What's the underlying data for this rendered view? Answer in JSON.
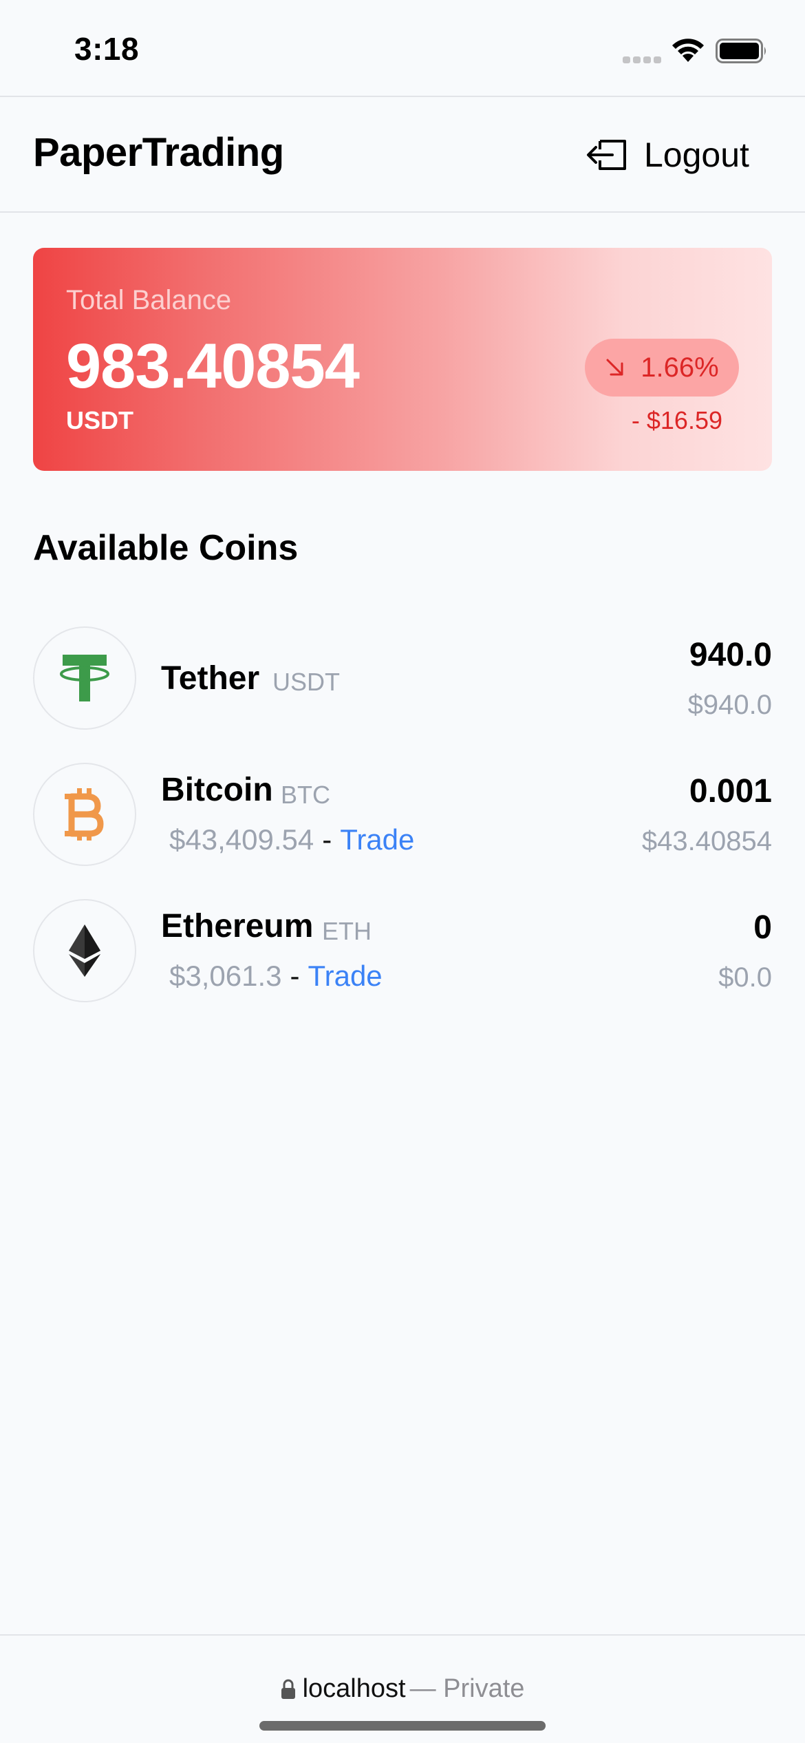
{
  "status_bar": {
    "time": "3:18"
  },
  "header": {
    "title": "PaperTrading",
    "logout_label": "Logout"
  },
  "balance": {
    "label": "Total Balance",
    "value": "983.40854",
    "currency": "USDT",
    "change_percent": "1.66%",
    "change_amount": "- $16.59",
    "change_direction": "down"
  },
  "coins_section": {
    "title": "Available Coins"
  },
  "coins": [
    {
      "name": "Tether",
      "symbol": "USDT",
      "price": "",
      "trade_label": "",
      "amount": "940.0",
      "value": "$940.0",
      "icon": "tether-icon",
      "color": "#3d9b4a"
    },
    {
      "name": "Bitcoin",
      "symbol": "BTC",
      "price": "$43,409.54",
      "separator": "-",
      "trade_label": "Trade",
      "amount": "0.001",
      "value": "$43.40854",
      "icon": "bitcoin-icon",
      "color": "#f0984a"
    },
    {
      "name": "Ethereum",
      "symbol": "ETH",
      "price": "$3,061.3",
      "separator": "-",
      "trade_label": "Trade",
      "amount": "0",
      "value": "$0.0",
      "icon": "ethereum-icon",
      "color": "#343434"
    }
  ],
  "browser": {
    "host": "localhost",
    "suffix": "— Private"
  },
  "colors": {
    "accent_red": "#ef4444",
    "link_blue": "#3b82f6",
    "muted_gray": "#9ca3af"
  }
}
